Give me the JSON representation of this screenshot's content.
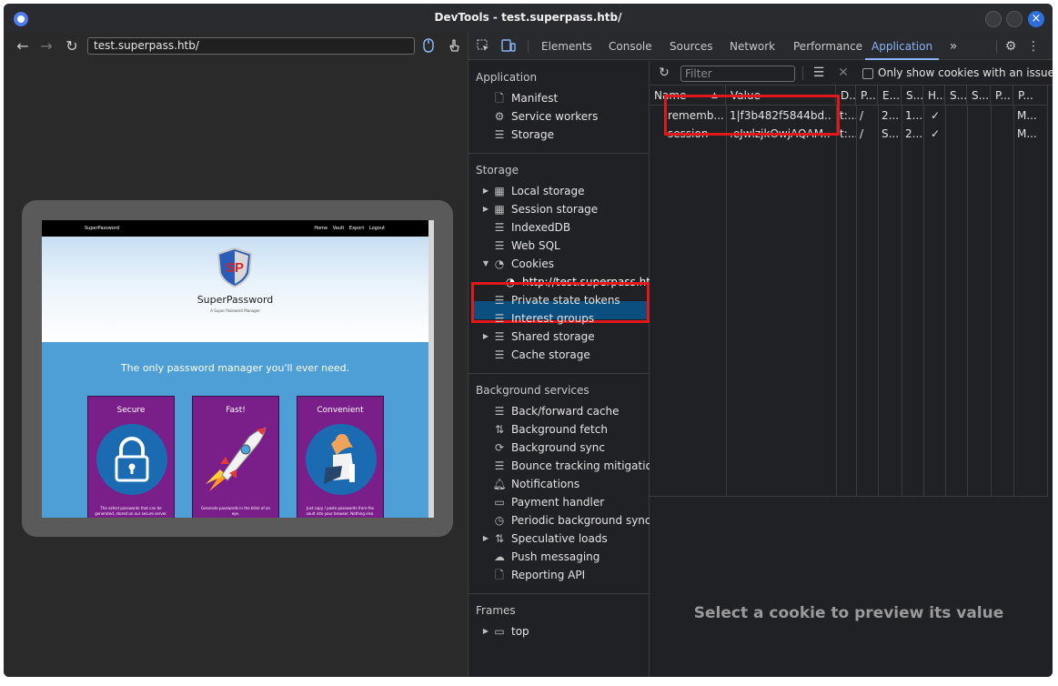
{
  "window": {
    "title": "DevTools - test.superpass.htb/"
  },
  "browser": {
    "url": "test.superpass.htb/",
    "site": {
      "brand": "SuperPassword",
      "nav_links": [
        "Home",
        "Vault",
        "Export",
        "Logout"
      ],
      "hero_title": "SuperPassword",
      "hero_subtitle": "A Super Password Manager",
      "logo_text": "SP",
      "tagline": "The only password manager you'll ever need.",
      "cards": [
        {
          "title": "Secure",
          "text": "The safest passwords that can be generated, stored on our secure server."
        },
        {
          "title": "Fast!",
          "text": "Generate passwords in the blink of an eye."
        },
        {
          "title": "Convenient",
          "text": "Just copy / paste passwords from the vault into your browser. Nothing else."
        }
      ]
    }
  },
  "devtools": {
    "tabs": [
      "Elements",
      "Console",
      "Sources",
      "Network",
      "Performance",
      "Application"
    ],
    "active_tab": "Application",
    "sidebar": {
      "application_title": "Application",
      "application_items": [
        "Manifest",
        "Service workers",
        "Storage"
      ],
      "storage_title": "Storage",
      "storage_items": [
        "Local storage",
        "Session storage",
        "IndexedDB",
        "Web SQL",
        "Cookies",
        "http://test.superpass.htb",
        "Private state tokens",
        "Interest groups",
        "Shared storage",
        "Cache storage"
      ],
      "background_title": "Background services",
      "background_items": [
        "Back/forward cache",
        "Background fetch",
        "Background sync",
        "Bounce tracking mitigations",
        "Notifications",
        "Payment handler",
        "Periodic background sync",
        "Speculative loads",
        "Push messaging",
        "Reporting API"
      ],
      "frames_title": "Frames",
      "frames_items": [
        "top"
      ]
    },
    "toolbar": {
      "filter_placeholder": "Filter",
      "only_issues_label": "Only show cookies with an issue"
    },
    "cookie_table": {
      "columns": [
        "Name",
        "Value",
        "D...",
        "P...",
        "E...",
        "S...",
        "H...",
        "S...",
        "S...",
        "P...",
        "P..."
      ],
      "rows": [
        [
          "rememb...",
          "1|f3b482f5844bd...",
          "t:...",
          "/",
          "2...",
          "1...",
          "✓",
          "",
          "",
          "",
          "M..."
        ],
        [
          "session",
          ".eJwlzjkOwjAQAM...",
          "t:...",
          "/",
          "S...",
          "2...",
          "✓",
          "",
          "",
          "",
          "M..."
        ]
      ]
    },
    "preview_message": "Select a cookie to preview its value"
  }
}
